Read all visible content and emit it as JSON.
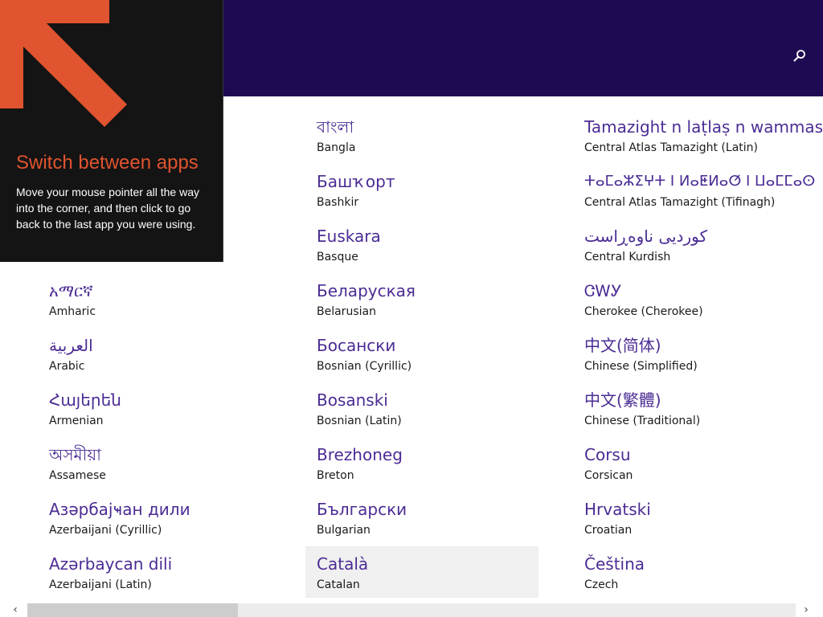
{
  "header": {
    "search_icon": "search-icon",
    "color": "#1e0a52"
  },
  "tip": {
    "title": "Switch between apps",
    "body": "Move your mouse pointer all the way into the corner, and then click to go back to the last app you were using.",
    "accent_color": "#e0542f",
    "arrow_icon": "corner-arrow-icon"
  },
  "languages": {
    "column1": [
      {
        "native": "አማርኛ",
        "english": "Amharic"
      },
      {
        "native": "العربية",
        "english": "Arabic"
      },
      {
        "native": "Հայերեն",
        "english": "Armenian"
      },
      {
        "native": "অসমীয়া",
        "english": "Assamese"
      },
      {
        "native": "Азәрбајҹан дили",
        "english": "Azerbaijani (Cyrillic)"
      },
      {
        "native": "Azərbaycan dili",
        "english": "Azerbaijani (Latin)"
      }
    ],
    "column2": [
      {
        "native": "বাংলা",
        "english": "Bangla"
      },
      {
        "native": "Башҡорт",
        "english": "Bashkir"
      },
      {
        "native": "Euskara",
        "english": "Basque"
      },
      {
        "native": "Беларуская",
        "english": "Belarusian"
      },
      {
        "native": "Босански",
        "english": "Bosnian (Cyrillic)"
      },
      {
        "native": "Bosanski",
        "english": "Bosnian (Latin)"
      },
      {
        "native": "Brezhoneg",
        "english": "Breton"
      },
      {
        "native": "Български",
        "english": "Bulgarian"
      },
      {
        "native": "Català",
        "english": "Catalan"
      }
    ],
    "column3": [
      {
        "native": "Tamazight n laṭlaṣ n wammas",
        "english": "Central Atlas Tamazight (Latin)"
      },
      {
        "native": "ⵜⴰⵎⴰⵣⵉⵖⵜ ⵏ ⵍⴰⵟⵍⴰⵚ ⵏ ⵡⴰⵎⵎⴰⵙ",
        "english": "Central Atlas Tamazight (Tifinagh)"
      },
      {
        "native": "کوردیی ناوەڕاست",
        "english": "Central Kurdish"
      },
      {
        "native": "ᏣᎳᎩ",
        "english": "Cherokee (Cherokee)"
      },
      {
        "native": "中文(简体)",
        "english": "Chinese (Simplified)"
      },
      {
        "native": "中文(繁體)",
        "english": "Chinese (Traditional)"
      },
      {
        "native": "Corsu",
        "english": "Corsican"
      },
      {
        "native": "Hrvatski",
        "english": "Croatian"
      },
      {
        "native": "Čeština",
        "english": "Czech"
      }
    ],
    "selected": "Catalan",
    "native_color": "#4b2c94"
  },
  "scrollbar": {
    "left_arrow": "‹",
    "right_arrow": "›",
    "position_fraction": 0.0
  }
}
